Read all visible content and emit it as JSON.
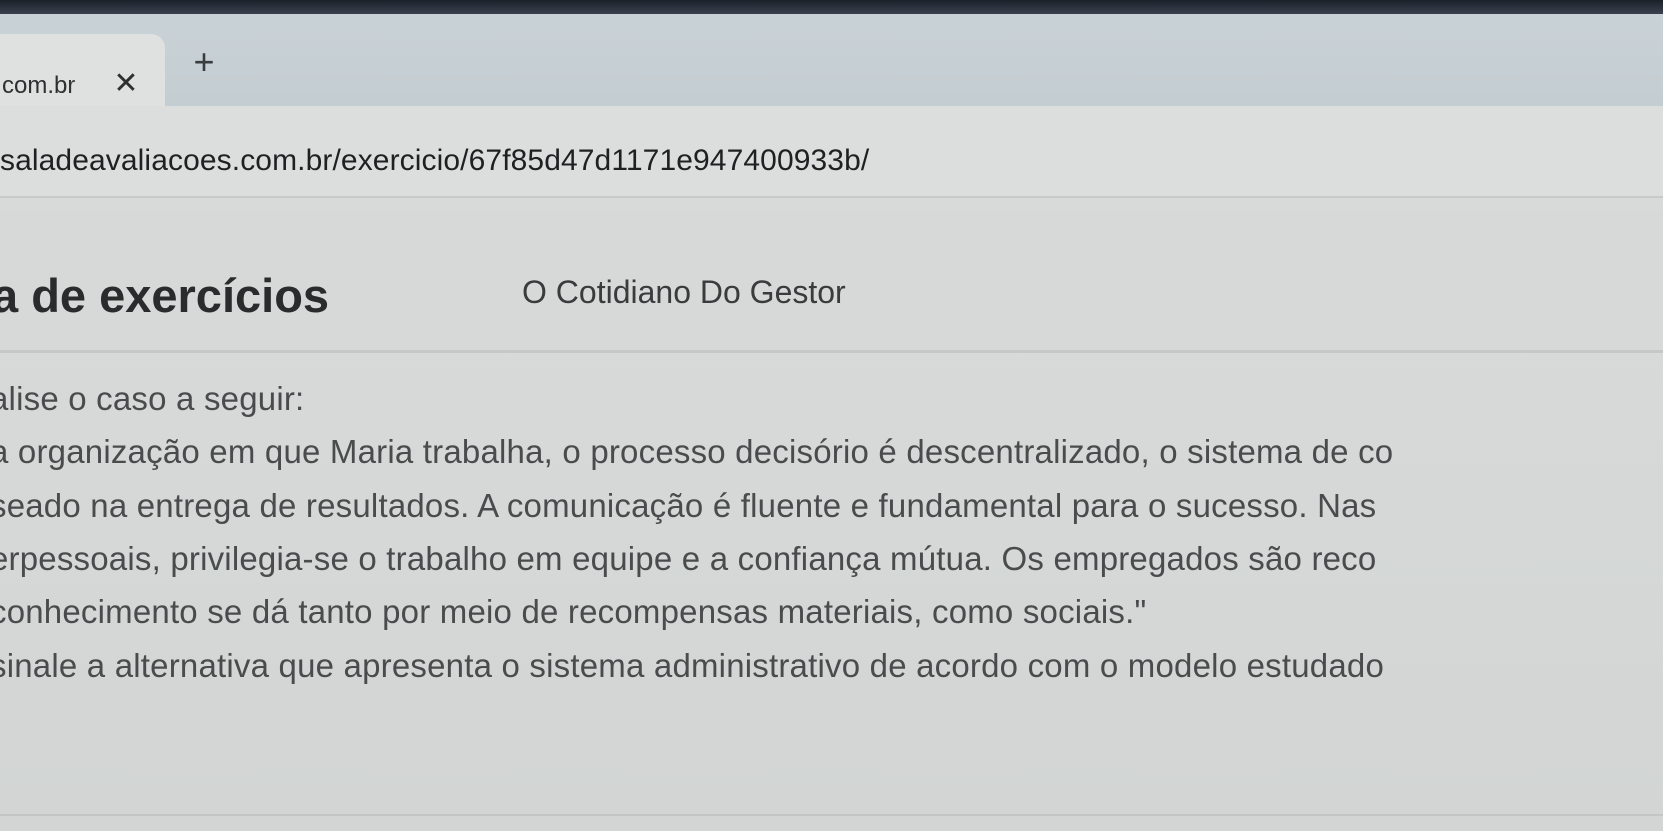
{
  "browser": {
    "tab": {
      "title": "com.br",
      "close_glyph": "✕",
      "close_icon": "close-icon"
    },
    "new_tab_glyph": "+",
    "new_tab_icon": "plus-icon",
    "url": "saladeavaliacoes.com.br/exercicio/67f85d47d1171e947400933b/"
  },
  "page": {
    "title": "a de exercícios",
    "subtitle": "O Cotidiano Do Gestor"
  },
  "question": {
    "lines": [
      "alise o caso a seguir:",
      "a organização em que Maria trabalha, o processo decisório é descentralizado, o sistema de co",
      "seado na entrega de resultados. A comunicação é fluente e fundamental para o sucesso. Nas",
      "erpessoais, privilegia-se o trabalho em equipe e a confiança mútua. Os empregados são reco",
      "conhecimento se dá tanto por meio de recompensas materiais, como sociais.\"",
      "sinale a alternativa que apresenta o sistema administrativo de acordo com o modelo estudado"
    ]
  },
  "colors": {
    "background": "#d9dcdb",
    "text": "#4a4b4d",
    "title": "#2a2b2d"
  }
}
